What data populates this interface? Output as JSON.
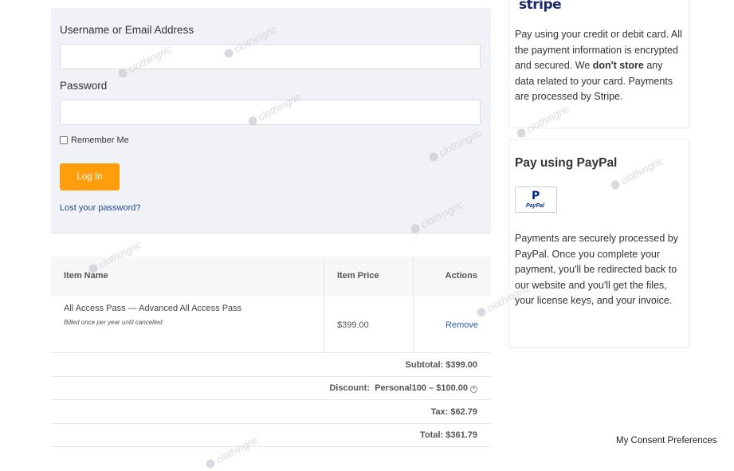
{
  "login": {
    "username_label": "Username or Email Address",
    "password_label": "Password",
    "remember_label": "Remember Me",
    "login_button": "Log In",
    "lost_password": "Lost your password?"
  },
  "cart": {
    "headers": [
      "Item Name",
      "Item Price",
      "Actions"
    ],
    "items": [
      {
        "name": "All Access Pass — Advanced All Access Pass",
        "note": "Billed once per year until cancelled",
        "price": "$399.00",
        "action": "Remove"
      }
    ],
    "subtotal": "Subtotal: $399.00",
    "discount_label": "Discount:",
    "discount_value": "Personal100 – $100.00",
    "tax": "Tax:  $62.79",
    "total": "Total: $361.79"
  },
  "stripe": {
    "logo": "stripe",
    "text_1": "Pay using your credit or debit card. All the payment information is encrypted and secured. We ",
    "text_bold_1": "don't store",
    "text_2": " any data related to your card. Payments are processed by Stripe."
  },
  "paypal": {
    "title": "Pay using PayPal",
    "logo_text": "PayPal",
    "description": "Payments are securely processed by PayPal. Once you complete your payment, you'll be redirected back to our website and you'll get the files, your license keys, and your invoice."
  },
  "footer": {
    "consent": "My Consent Preferences"
  },
  "watermark": "clothingric",
  "colors": {
    "accent": "#ff9e0c",
    "link": "#1f4d8f",
    "panel_bg": "#f1f2f7"
  }
}
